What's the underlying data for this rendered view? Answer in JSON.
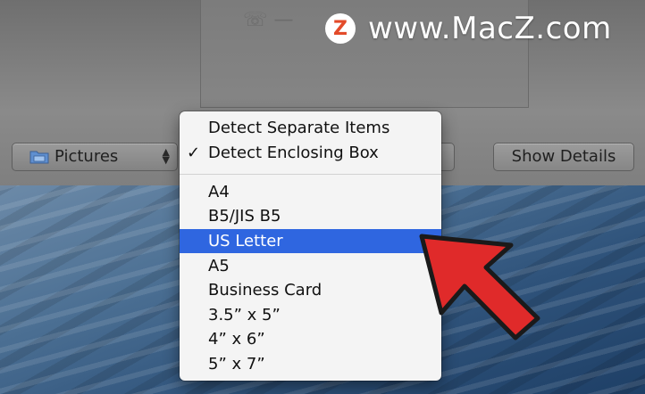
{
  "watermark": {
    "logo_letter": "Z",
    "text": "www.MacZ.com"
  },
  "toolbar": {
    "folder_select_label": "Pictures",
    "show_details_label": "Show Details"
  },
  "menu": {
    "items": [
      {
        "label": "Detect Separate Items",
        "checked": false,
        "selected": false
      },
      {
        "label": "Detect Enclosing Box",
        "checked": true,
        "selected": false
      },
      {
        "label": "A4",
        "checked": false,
        "selected": false
      },
      {
        "label": "B5/JIS B5",
        "checked": false,
        "selected": false
      },
      {
        "label": "US Letter",
        "checked": false,
        "selected": true
      },
      {
        "label": "A5",
        "checked": false,
        "selected": false
      },
      {
        "label": "Business Card",
        "checked": false,
        "selected": false
      },
      {
        "label": "3.5” x 5”",
        "checked": false,
        "selected": false
      },
      {
        "label": "4” x 6”",
        "checked": false,
        "selected": false
      },
      {
        "label": "5” x 7”",
        "checked": false,
        "selected": false
      }
    ],
    "check_glyph": "✓"
  },
  "colors": {
    "selection": "#2f66e0",
    "arrow": "#e02a2a",
    "watermark_logo": "#e34b2a"
  },
  "icons": {
    "folder": "folder-icon",
    "updown": "updown-chevron-icon",
    "arrow": "red-pointer-arrow"
  }
}
